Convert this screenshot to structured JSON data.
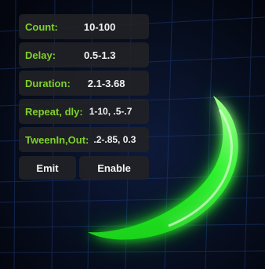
{
  "fields": [
    {
      "label": "Count:",
      "value": "10-100"
    },
    {
      "label": "Delay:",
      "value": "0.5-1.3"
    },
    {
      "label": "Duration:",
      "value": "2.1-3.68"
    },
    {
      "label": "Repeat, dly:",
      "value": "1-10, .5-.7"
    },
    {
      "label": "TweenIn,Out:",
      "value": ".2-.85, 0.3"
    }
  ],
  "buttons": {
    "emit": "Emit",
    "enable": "Enable"
  },
  "colors": {
    "label_green": "#7fd12a",
    "glow_green": "#3cff3c",
    "panel_bg": "#222226",
    "background": "#050914"
  }
}
